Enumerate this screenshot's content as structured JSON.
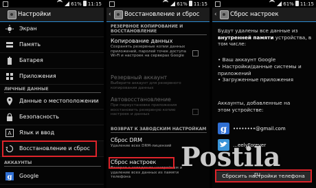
{
  "status_bar": {
    "battery": "61%",
    "time": "11:15"
  },
  "panel1": {
    "title": "Настройки",
    "items_top": [
      {
        "label": "Экран",
        "icon": "brightness-icon"
      },
      {
        "label": "Память",
        "icon": "storage-icon"
      },
      {
        "label": "Батарея",
        "icon": "battery-icon"
      },
      {
        "label": "Приложения",
        "icon": "apps-icon"
      }
    ],
    "section_personal": "ЛИЧНЫЕ ДАННЫЕ",
    "items_personal": [
      {
        "label": "Данные о местоположении",
        "icon": "location-icon"
      },
      {
        "label": "Безопасность",
        "icon": "lock-icon"
      },
      {
        "label": "Язык и ввод",
        "icon": "language-icon"
      },
      {
        "label": "Восстановление и сброс",
        "icon": "restore-icon"
      }
    ],
    "section_accounts": "АККАУНТЫ",
    "items_accounts": [
      {
        "label": "Google",
        "icon": "google-icon"
      }
    ]
  },
  "panel2": {
    "title": "Восстановление и сброс",
    "section_backup": "РЕЗЕРВНОЕ КОПИРОВАНИЕ И ВОССТАНОВЛЕНИЕ",
    "backup_data": {
      "title": "Копирование данных",
      "desc": "Сохранять резервные копии данных приложений, паролей точек доступа Wi-Fi и настроек на серверах Google"
    },
    "backup_account": {
      "title": "Резервный аккаунт",
      "desc": "Выберите аккаунт для резервного копирования данных"
    },
    "auto_restore": {
      "title": "Автовосстановление",
      "desc": "При переустановке приложения восстановить резервную копию настроек и данных"
    },
    "section_reset": "ВОЗВРАТ К ЗАВОДСКИМ НАСТРОЙКАМ",
    "drm_reset": {
      "title": "Сброс DRM",
      "desc": "Удаление всех DRM-лицензий"
    },
    "factory_reset": {
      "title": "Сброс настроек",
      "desc": "Возврат к заводским настройкам и удаление всех данных из памяти телефона"
    }
  },
  "panel3": {
    "title": "Сброс настроек",
    "intro_1": "Будут удалены все данные из ",
    "intro_bold": "внутренней памяти",
    "intro_2": " устройства, в том числе:",
    "bullets": [
      "• Ваш аккаунт Google",
      "• Настройки/данные системы и приложений",
      "• Загруженные приложения"
    ],
    "accounts_text": "Аккаунты, добавленные на этом устройстве:",
    "accounts": [
      {
        "name": "••••••••@gmail.com",
        "type": "google"
      },
      {
        "name": "…eelyForever",
        "type": "twitter"
      }
    ],
    "reset_button": "Сбросить настройки телефона"
  },
  "watermark": {
    "text": "Postila",
    "suffix": ".ru"
  },
  "colors": {
    "accent": "#2c8bd3",
    "highlight": "#e0242b",
    "google": "#2f6fd3",
    "twitter": "#3a94d8"
  }
}
